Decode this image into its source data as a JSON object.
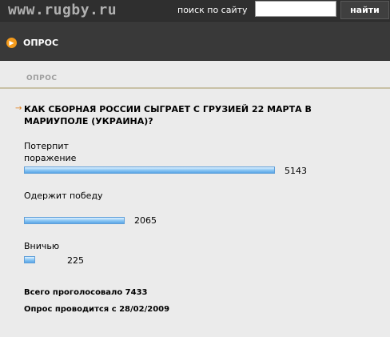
{
  "header": {
    "logo": "www.rugby.ru",
    "search_label": "поиск по сайту",
    "search_placeholder": "",
    "search_button": "найти"
  },
  "section": {
    "title": "ОПРОС",
    "breadcrumb": "ОПРОС"
  },
  "poll": {
    "question": "КАК СБОРНАЯ РОССИИ СЫГРАЕТ С ГРУЗИЕЙ 22 МАРТА В МАРИУПОЛЕ (УКРАИНА)?",
    "options": [
      {
        "label": "Потерпит поражение",
        "votes": 5143
      },
      {
        "label": "Одержит победу",
        "votes": 2065
      },
      {
        "label": "Вничью",
        "votes": 225
      }
    ],
    "total_text": "Всего проголосовало 7433",
    "since_text": "Опрос проводится с 28/02/2009"
  }
}
